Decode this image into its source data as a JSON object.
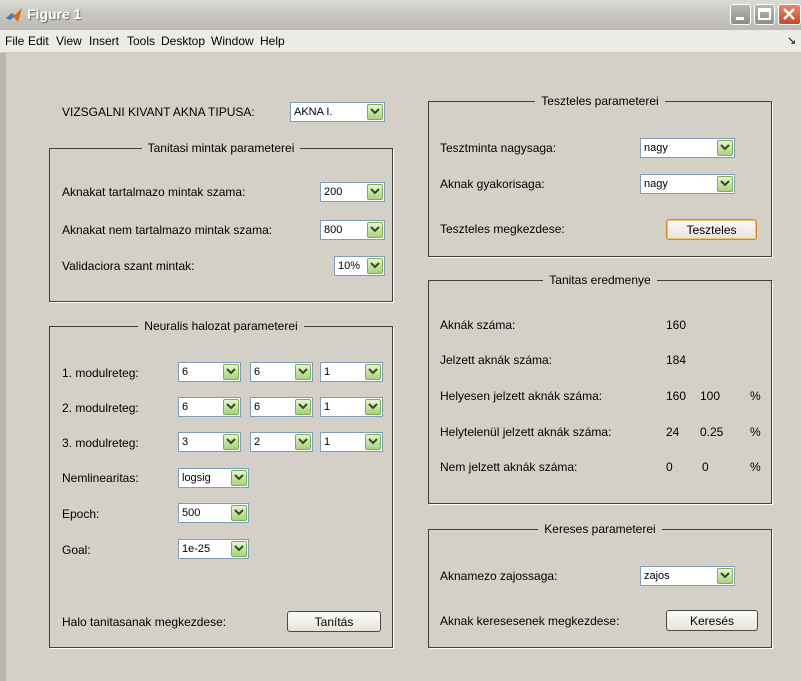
{
  "window": {
    "title": "Figure 1"
  },
  "menu": [
    "File",
    "Edit",
    "View",
    "Insert",
    "Tools",
    "Desktop",
    "Window",
    "Help"
  ],
  "mine_type": {
    "label": "VIZSGALNI KIVANT AKNA TIPUSA:",
    "value": "AKNA I."
  },
  "training_params": {
    "title": "Tanitasi mintak parameterei",
    "rows": [
      {
        "label": "Aknakat tartalmazo mintak szama:",
        "value": "200"
      },
      {
        "label": "Aknakat nem tartalmazo mintak szama:",
        "value": "800"
      },
      {
        "label": "Validaciora szant mintak:",
        "value": "10%"
      }
    ]
  },
  "network_params": {
    "title": "Neuralis halozat parameterei",
    "layers": [
      {
        "label": "1. modulreteg:",
        "values": [
          "6",
          "6",
          "1"
        ]
      },
      {
        "label": "2. modulreteg:",
        "values": [
          "6",
          "6",
          "1"
        ]
      },
      {
        "label": "3. modulreteg:",
        "values": [
          "3",
          "2",
          "1"
        ]
      }
    ],
    "nonlinearity": {
      "label": "Nemlinearitas:",
      "value": "logsig"
    },
    "epoch": {
      "label": "Epoch:",
      "value": "500"
    },
    "goal": {
      "label": "Goal:",
      "value": "1e-25"
    },
    "start": {
      "label": "Halo tanitasanak megkezdese:",
      "button": "Tanítás"
    }
  },
  "test_params": {
    "title": "Teszteles parameterei",
    "size": {
      "label": "Tesztminta nagysaga:",
      "value": "nagy"
    },
    "frequency": {
      "label": "Aknak gyakorisaga:",
      "value": "nagy"
    },
    "start": {
      "label": "Teszteles megkezdese:",
      "button": "Teszteles"
    }
  },
  "results": {
    "title": "Tanitas eredmenye",
    "rows": [
      {
        "label": "Aknák száma:",
        "count": "160",
        "ratio": "",
        "unit": ""
      },
      {
        "label": "Jelzett aknák száma:",
        "count": "184",
        "ratio": "",
        "unit": ""
      },
      {
        "label": "Helyesen jelzett aknák száma:",
        "count": "160",
        "ratio": "100",
        "unit": "%"
      },
      {
        "label": "Helytelenül jelzett aknák száma:",
        "count": "24",
        "ratio": "0.25",
        "unit": "%"
      },
      {
        "label": "Nem jelzett aknák száma:",
        "count": "0",
        "ratio": "0",
        "unit": "%"
      }
    ]
  },
  "search_params": {
    "title": "Kereses parameterei",
    "noise": {
      "label": "Aknamezo zajossaga:",
      "value": "zajos"
    },
    "start": {
      "label": "Aknak keresesenek megkezdese:",
      "button": "Keresés"
    }
  },
  "icons": [
    "matlab-logo-icon",
    "minimize-icon",
    "maximize-icon",
    "close-icon",
    "chevron-down-icon"
  ]
}
